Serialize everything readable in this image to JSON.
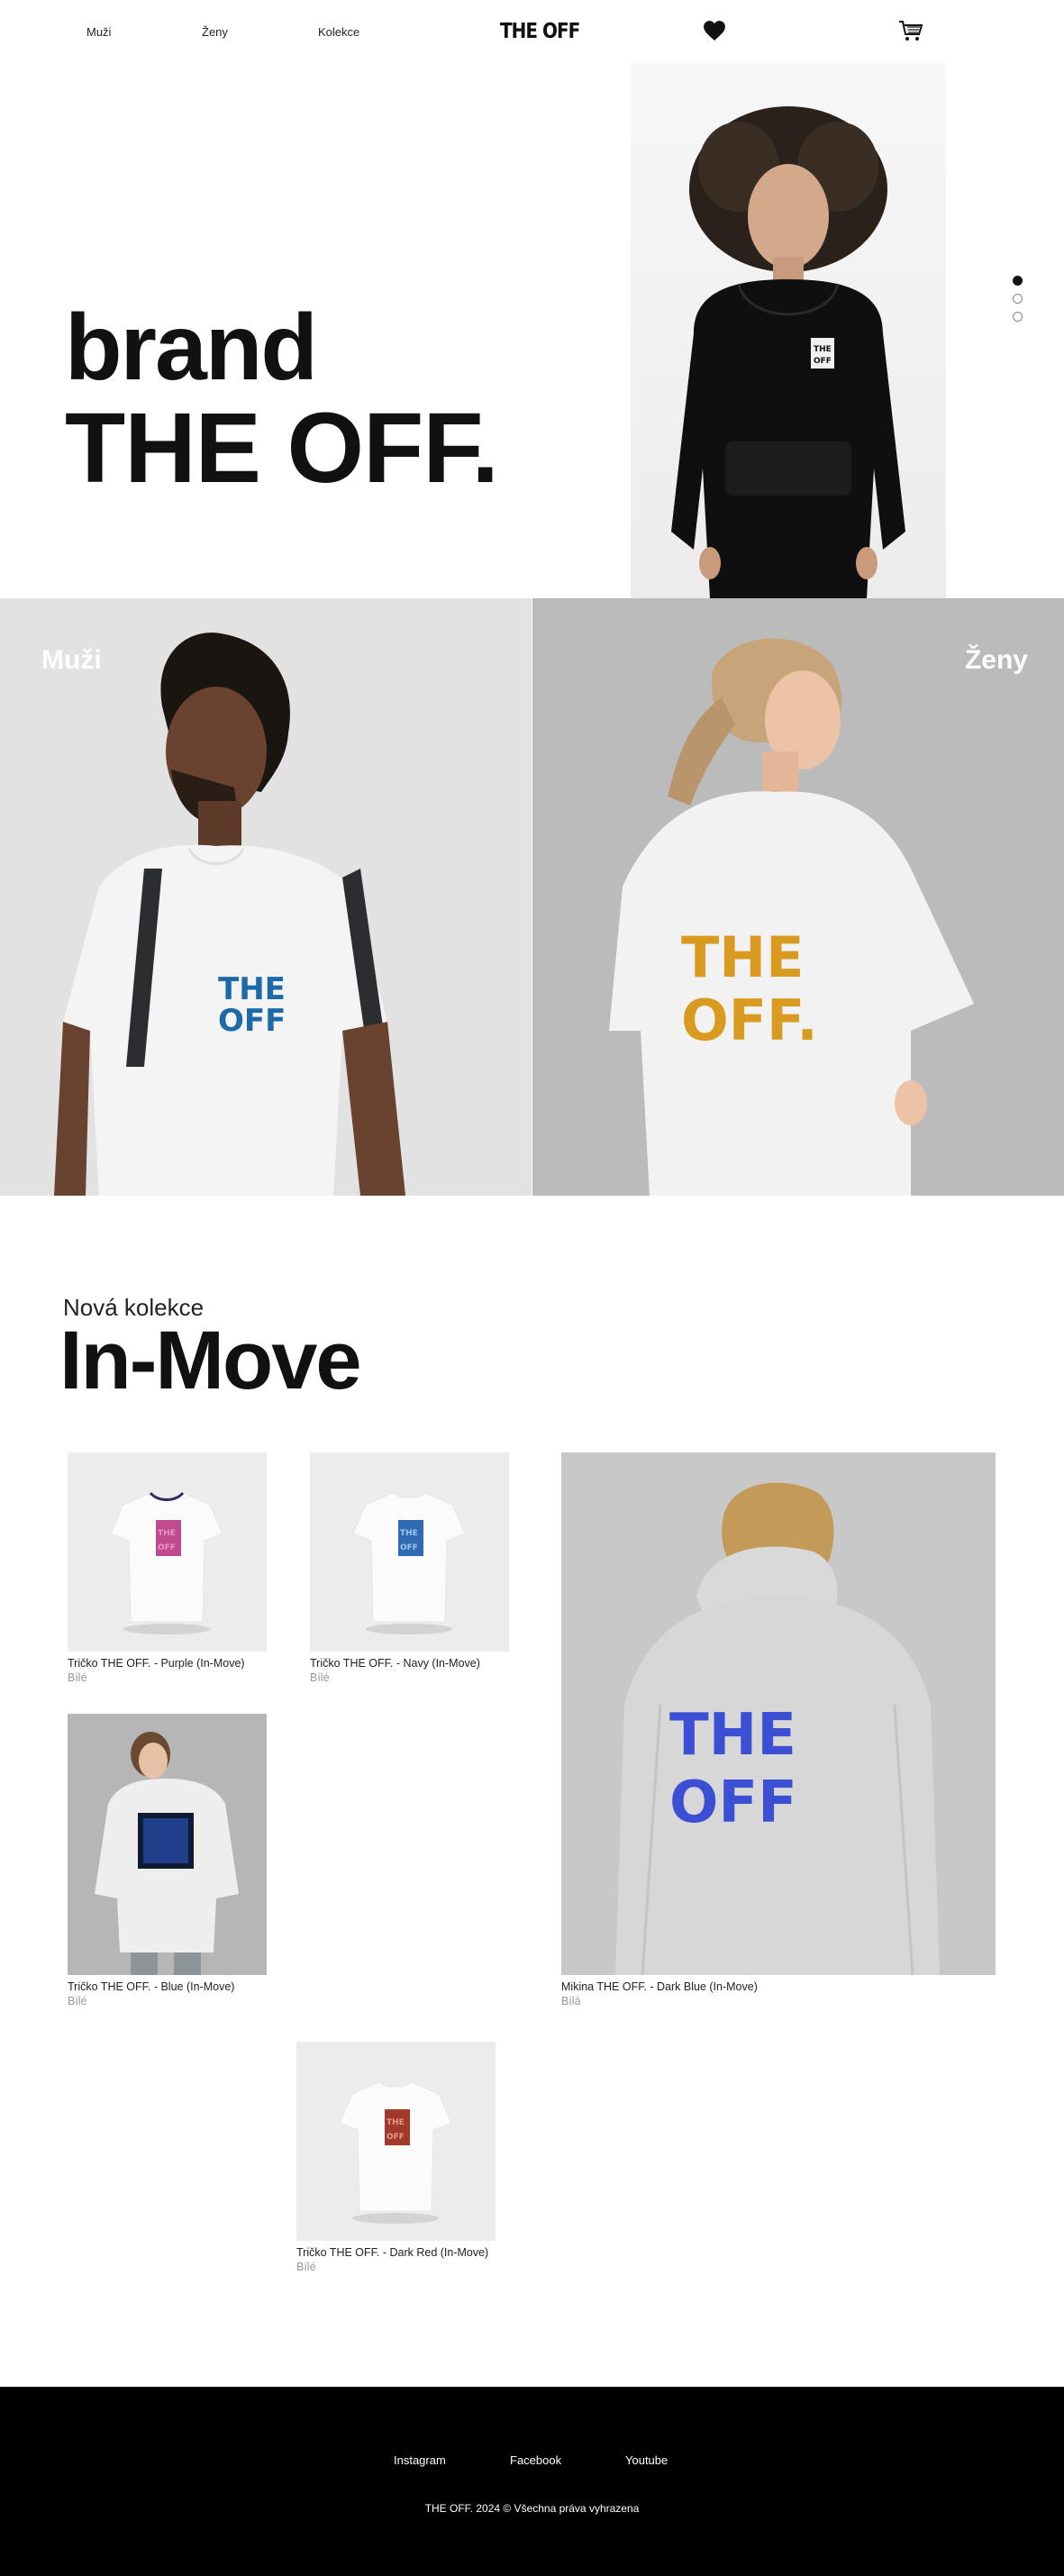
{
  "header": {
    "nav": [
      {
        "label": "Muži"
      },
      {
        "label": "Ženy"
      },
      {
        "label": "Kolekce"
      }
    ],
    "logo": "THE OFF",
    "favorites_icon": "heart-icon",
    "cart_icon": "cart-icon"
  },
  "hero": {
    "line1": "brand",
    "line2": "THE OFF.",
    "slides": 3,
    "active_slide": 1
  },
  "categories": [
    {
      "label": "Muži"
    },
    {
      "label": "Ženy"
    }
  ],
  "collection": {
    "subtitle": "Nová kolekce",
    "title": "In-Move",
    "products": [
      {
        "name": "Tričko THE OFF. - Purple (In-Move)",
        "color": "Bílé"
      },
      {
        "name": "Tričko THE OFF. - Navy (In-Move)",
        "color": "Bílé"
      },
      {
        "name": "Mikina THE OFF. - Dark Blue (In-Move)",
        "color": "Bílá"
      },
      {
        "name": "Tričko THE OFF. - Blue (In-Move)",
        "color": "Bílé"
      },
      {
        "name": "Tričko THE OFF. - Dark Red (In-Move)",
        "color": "Bílé"
      }
    ]
  },
  "footer": {
    "links": [
      {
        "label": "Instagram"
      },
      {
        "label": "Facebook"
      },
      {
        "label": "Youtube"
      }
    ],
    "copyright": "THE OFF. 2024 © Všechna práva vyhrazena"
  }
}
